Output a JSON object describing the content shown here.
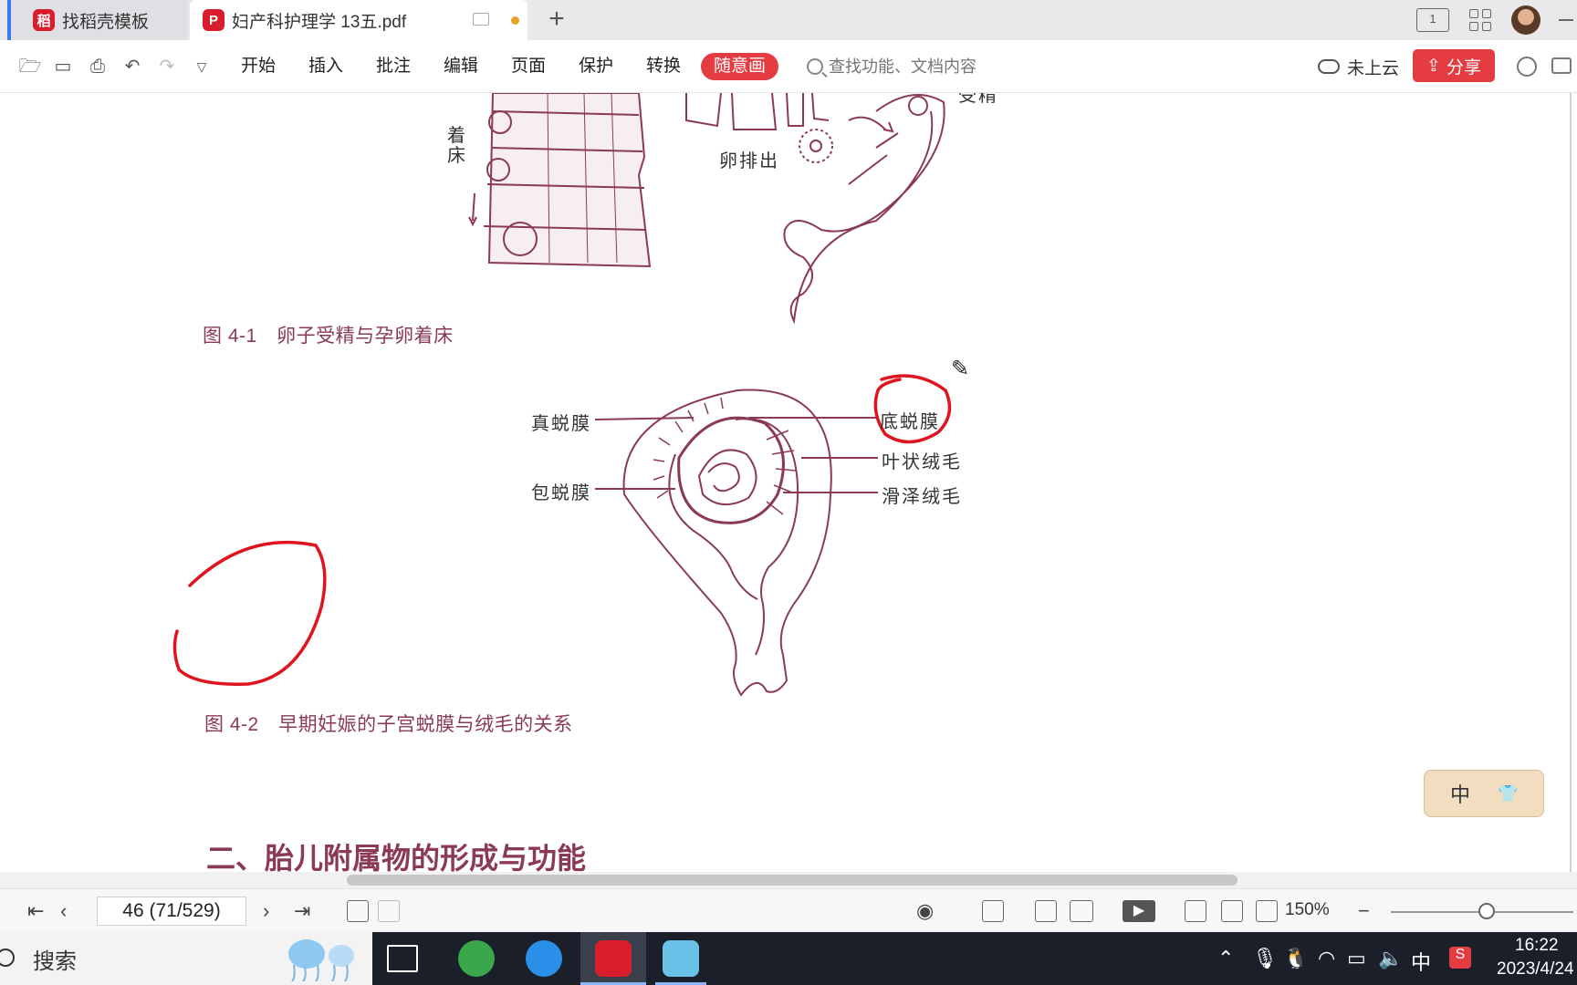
{
  "tabs": [
    {
      "title": "找稻壳模板",
      "logo": "稻"
    },
    {
      "title": "妇产科护理学 13五.pdf",
      "logo": "P"
    }
  ],
  "new_tab_icon": "plus-icon",
  "ribbon": {
    "menus": [
      "开始",
      "插入",
      "批注",
      "编辑",
      "页面",
      "保护",
      "转换",
      "随意画"
    ],
    "active_menu": "随意画",
    "search_placeholder": "查找功能、文档内容",
    "cloud_label": "未上云",
    "share_label": "分享"
  },
  "document": {
    "figure1": {
      "caption": "图 4-1　卵子受精与孕卵着床",
      "labels": {
        "implant_1": "着",
        "implant_2": "床",
        "ovulation": "卵排出",
        "fertilize": "受精"
      }
    },
    "figure2": {
      "caption": "图 4-2　早期妊娠的子宫蜕膜与绒毛的关系",
      "labels": {
        "true_decidua": "真蜕膜",
        "capsular_decidua": "包蜕膜",
        "basal_decidua": "底蜕膜",
        "chorion_frondosum": "叶状绒毛",
        "chorion_laeve": "滑泽绒毛"
      }
    },
    "section_heading": "二、胎儿附属物的形成与功能",
    "annotation_color": "#e0141e",
    "ime_widget_label": "中"
  },
  "statusbar": {
    "page_value": "46 (71/529)",
    "zoom": "150%"
  },
  "taskbar": {
    "search_label": "搜索",
    "tray_lang": "中",
    "time": "16:22",
    "date": "2023/4/24"
  }
}
